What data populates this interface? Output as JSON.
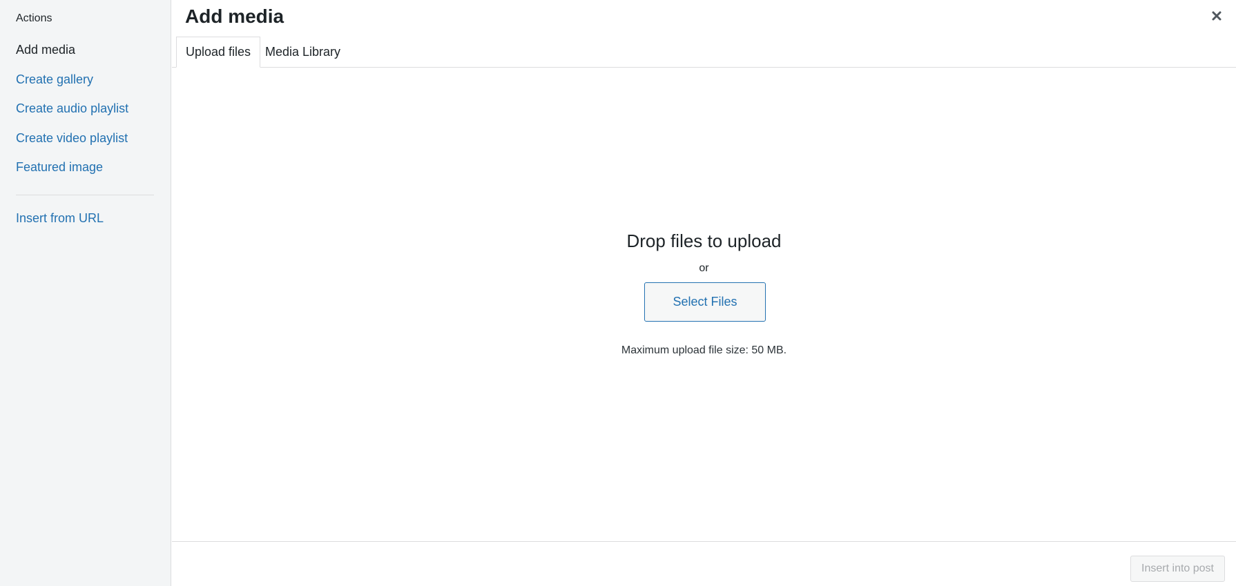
{
  "sidebar": {
    "heading": "Actions",
    "items": [
      {
        "label": "Add media",
        "active": true
      },
      {
        "label": "Create gallery"
      },
      {
        "label": "Create audio playlist"
      },
      {
        "label": "Create video playlist"
      },
      {
        "label": "Featured image"
      }
    ],
    "extra_items": [
      {
        "label": "Insert from URL"
      }
    ]
  },
  "header": {
    "title": "Add media",
    "close_icon": "close-icon"
  },
  "tabs": [
    {
      "label": "Upload files",
      "active": true
    },
    {
      "label": "Media Library"
    }
  ],
  "uploader": {
    "drop_text": "Drop files to upload",
    "or_text": "or",
    "select_button": "Select Files",
    "max_size": "Maximum upload file size: 50 MB."
  },
  "footer": {
    "insert_button": "Insert into post"
  },
  "colors": {
    "link": "#2271b1",
    "text": "#1d2327",
    "sidebar_bg": "#f3f5f6",
    "disabled_text": "#a7aaad"
  }
}
